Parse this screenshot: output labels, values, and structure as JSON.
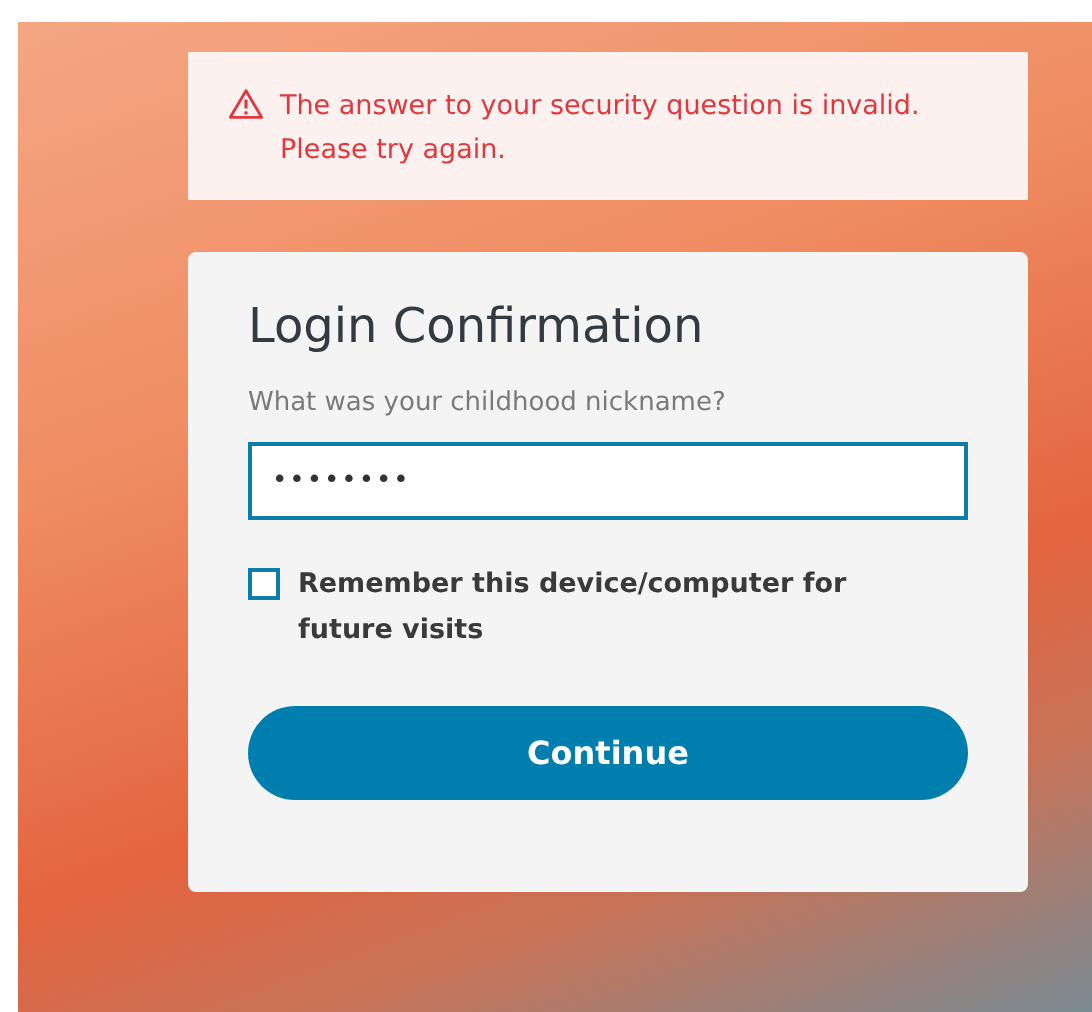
{
  "alert": {
    "message": "The answer to your security question is invalid. Please try again."
  },
  "card": {
    "title": "Login Confirmation",
    "question": "What was your childhood nickname?",
    "answer": "••••••••",
    "remember": {
      "label": "Remember this device/computer for future visits",
      "checked": false
    },
    "button": "Continue"
  }
}
